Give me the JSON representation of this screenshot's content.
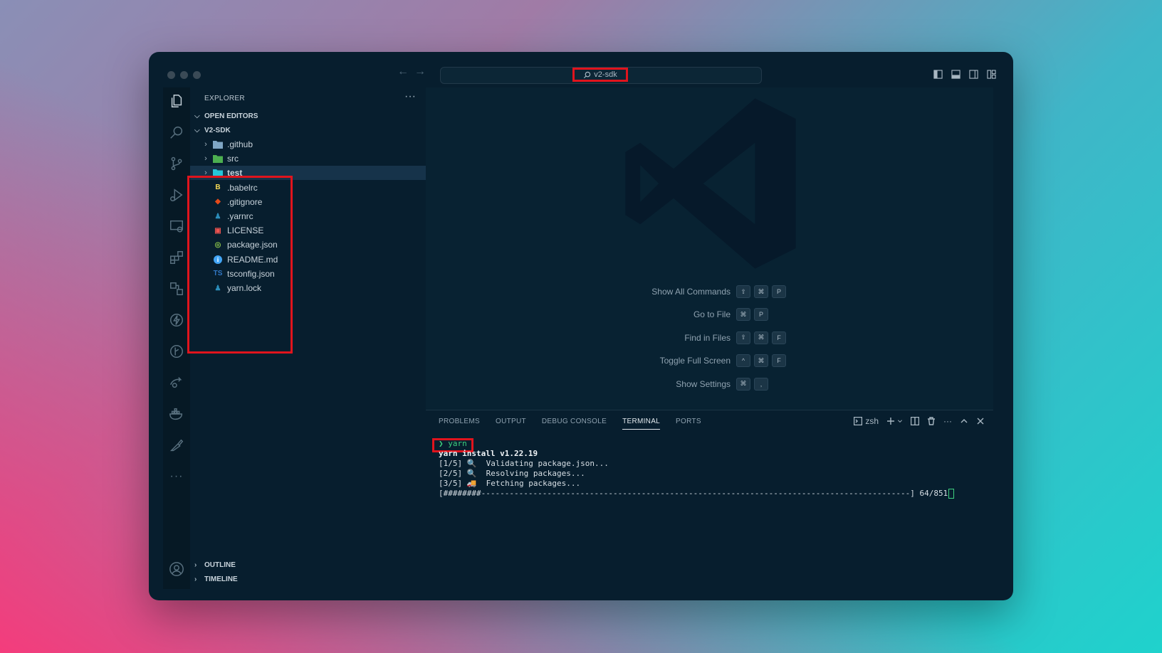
{
  "window": {
    "command_center": "v2-sdk",
    "nav_back": "←",
    "nav_forward": "→"
  },
  "sidebar": {
    "title": "EXPLORER",
    "more": "···",
    "open_editors": "OPEN EDITORS",
    "workspace": "V2-SDK",
    "items": [
      {
        "name": ".github",
        "kind": "folder",
        "icon": "github-folder-icon",
        "color": "#7fa6c4"
      },
      {
        "name": "src",
        "kind": "folder",
        "icon": "src-folder-icon",
        "color": "#4caf50"
      },
      {
        "name": "test",
        "kind": "folder",
        "icon": "test-folder-icon",
        "color": "#26c6da"
      },
      {
        "name": ".babelrc",
        "kind": "file",
        "icon": "babel-icon",
        "color": "#f5da55"
      },
      {
        "name": ".gitignore",
        "kind": "file",
        "icon": "git-icon",
        "color": "#e64a19"
      },
      {
        "name": ".yarnrc",
        "kind": "file",
        "icon": "yarn-icon",
        "color": "#2c8ebb"
      },
      {
        "name": "LICENSE",
        "kind": "file",
        "icon": "license-icon",
        "color": "#ef5350"
      },
      {
        "name": "package.json",
        "kind": "file",
        "icon": "npm-icon",
        "color": "#8bc34a"
      },
      {
        "name": "README.md",
        "kind": "file",
        "icon": "info-icon",
        "color": "#42a5f5"
      },
      {
        "name": "tsconfig.json",
        "kind": "file",
        "icon": "tsconfig-icon",
        "color": "#3178c6"
      },
      {
        "name": "yarn.lock",
        "kind": "file",
        "icon": "yarn-icon",
        "color": "#2c8ebb"
      }
    ],
    "outline": "OUTLINE",
    "timeline": "TIMELINE"
  },
  "editor": {
    "shortcuts": [
      {
        "label": "Show All Commands",
        "keys": [
          "⇧",
          "⌘",
          "P"
        ]
      },
      {
        "label": "Go to File",
        "keys": [
          "⌘",
          "P"
        ]
      },
      {
        "label": "Find in Files",
        "keys": [
          "⇧",
          "⌘",
          "F"
        ]
      },
      {
        "label": "Toggle Full Screen",
        "keys": [
          "^",
          "⌘",
          "F"
        ]
      },
      {
        "label": "Show Settings",
        "keys": [
          "⌘",
          ","
        ]
      }
    ]
  },
  "panel": {
    "tabs": [
      "PROBLEMS",
      "OUTPUT",
      "DEBUG CONSOLE",
      "TERMINAL",
      "PORTS"
    ],
    "active_tab": "TERMINAL",
    "shell": "zsh",
    "terminal": {
      "prompt_symbol": "❯",
      "command": "yarn",
      "lines": [
        "yarn install v1.22.19",
        "[1/5] 🔍  Validating package.json...",
        "[2/5] 🔍  Resolving packages...",
        "[3/5] 🚚  Fetching packages..."
      ],
      "progress_bar": "[########-------------------------------------------------------------------------------------------] 64/851"
    }
  },
  "colors": {
    "highlight": "#e0141d",
    "window_bg": "#071e2e",
    "accent_green": "#3fd07f"
  }
}
